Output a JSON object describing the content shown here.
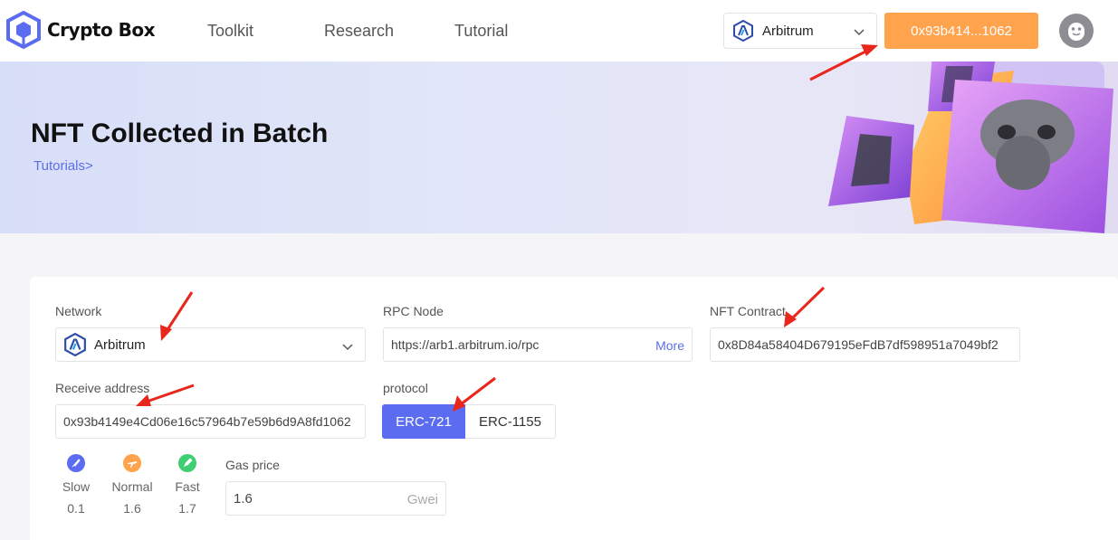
{
  "header": {
    "brand": "Crypto Box",
    "nav": [
      "Toolkit",
      "Research",
      "Tutorial"
    ],
    "network": "Arbitrum",
    "wallet": "0x93b414...1062"
  },
  "banner": {
    "title": "NFT Collected in Batch",
    "link": "Tutorials>"
  },
  "form": {
    "network_label": "Network",
    "network_value": "Arbitrum",
    "rpc_label": "RPC Node",
    "rpc_value": "https://arb1.arbitrum.io/rpc",
    "rpc_more": "More",
    "contract_label": "NFT Contract",
    "contract_value": "0x8D84a58404D679195eFdB7df598951a7049bf2",
    "receive_label": "Receive address",
    "receive_value": "0x93b4149e4Cd06e16c57964b7e59b6d9A8fd1062",
    "protocol_label": "protocol",
    "protocols": [
      "ERC-721",
      "ERC-1155"
    ],
    "speeds": [
      {
        "name": "Slow",
        "value": "0.1",
        "color": "#5b6cf0",
        "icon": "rocket-icon"
      },
      {
        "name": "Normal",
        "value": "1.6",
        "color": "#ffa34d",
        "icon": "plane-icon"
      },
      {
        "name": "Fast",
        "value": "1.7",
        "color": "#3fcf72",
        "icon": "rocket-icon"
      }
    ],
    "gas_label": "Gas price",
    "gas_value": "1.6",
    "gas_unit": "Gwei"
  },
  "colors": {
    "accent": "#5b6cf0",
    "wallet_button": "#ffa34d",
    "annotation_arrow": "#e8261c"
  }
}
